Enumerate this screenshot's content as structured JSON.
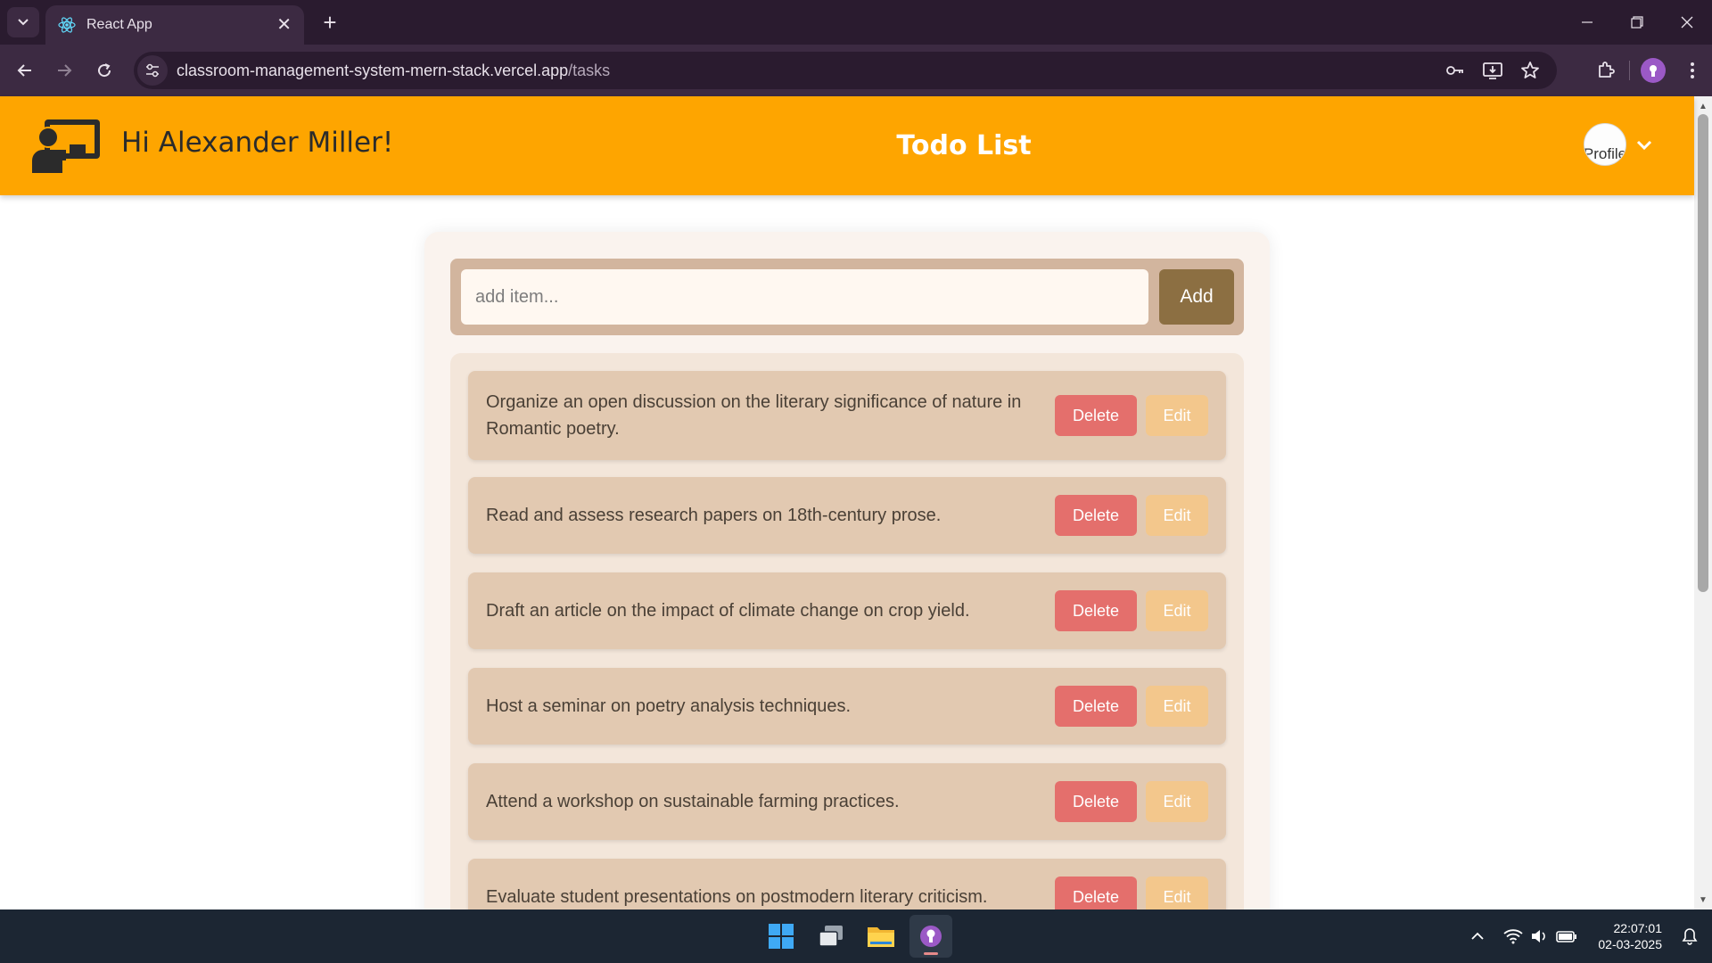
{
  "browser": {
    "tab_title": "React App",
    "tab_close": "✕",
    "new_tab": "+",
    "url_host": "classroom-management-system-mern-stack.vercel.app",
    "url_path": "/tasks"
  },
  "header": {
    "greeting": "Hi Alexander Miller!",
    "title": "Todo List",
    "profile_alt": "Profile"
  },
  "add_form": {
    "placeholder": "add item...",
    "button_label": "Add"
  },
  "todos": [
    {
      "text": "Organize an open discussion on the literary significance of nature in Romantic poetry.",
      "delete_label": "Delete",
      "edit_label": "Edit"
    },
    {
      "text": "Read and assess research papers on 18th-century prose.",
      "delete_label": "Delete",
      "edit_label": "Edit"
    },
    {
      "text": "Draft an article on the impact of climate change on crop yield.",
      "delete_label": "Delete",
      "edit_label": "Edit"
    },
    {
      "text": "Host a seminar on poetry analysis techniques.",
      "delete_label": "Delete",
      "edit_label": "Edit"
    },
    {
      "text": "Attend a workshop on sustainable farming practices.",
      "delete_label": "Delete",
      "edit_label": "Edit"
    },
    {
      "text": "Evaluate student presentations on postmodern literary criticism.",
      "delete_label": "Delete",
      "edit_label": "Edit"
    }
  ],
  "taskbar": {
    "time": "22:07:01",
    "date": "02-03-2025"
  },
  "colors": {
    "header_bg": "#fea500",
    "delete_btn": "#e46f6c",
    "edit_btn": "#f3c78c",
    "add_btn": "#8c6f42",
    "item_bg": "#e2c9b1"
  }
}
